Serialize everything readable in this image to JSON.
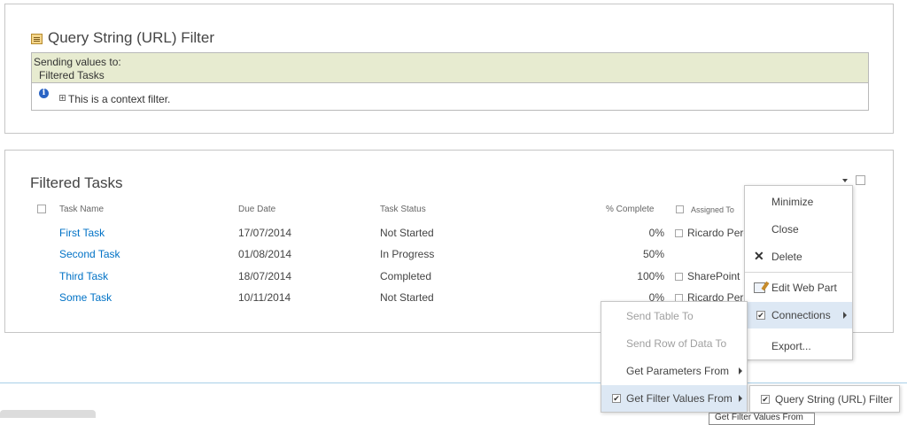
{
  "query_filter_part": {
    "title": "Query String (URL) Filter",
    "sending_label": "Sending values to:",
    "sending_target": "Filtered Tasks",
    "context_note": "This is a context filter."
  },
  "tasks_part": {
    "title": "Filtered Tasks",
    "columns": {
      "name": "Task Name",
      "due": "Due Date",
      "status": "Task Status",
      "complete": "% Complete",
      "assigned": "Assigned To"
    },
    "rows": [
      {
        "name": "First Task",
        "due": "17/07/2014",
        "status": "Not Started",
        "complete": "0%",
        "assigned": "Ricardo Pere"
      },
      {
        "name": "Second Task",
        "due": "01/08/2014",
        "status": "In Progress",
        "complete": "50%",
        "assigned": ""
      },
      {
        "name": "Third Task",
        "due": "18/07/2014",
        "status": "Completed",
        "complete": "100%",
        "assigned": "SharePoint"
      },
      {
        "name": "Some Task",
        "due": "10/11/2014",
        "status": "Not Started",
        "complete": "0%",
        "assigned": "Ricardo Pere"
      }
    ]
  },
  "webpart_menu": {
    "minimize": "Minimize",
    "close": "Close",
    "delete": "Delete",
    "edit_web_part": "Edit Web Part",
    "connections": "Connections",
    "export": "Export..."
  },
  "connections_menu": {
    "send_table_to": "Send Table To",
    "send_row_to": "Send Row of Data To",
    "get_parameters_from": "Get Parameters From",
    "get_filter_values_from": "Get Filter Values From"
  },
  "filter_source_menu": {
    "query_string_filter": "Query String (URL) Filter"
  },
  "tooltip": "Get Filter Values From",
  "colors": {
    "link": "#0072c6",
    "banner": "#e7ebd0",
    "highlight": "#dde8f4"
  }
}
